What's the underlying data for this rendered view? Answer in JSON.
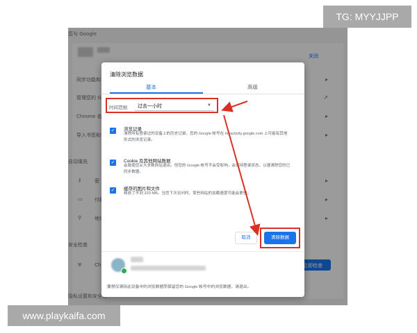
{
  "watermarks": {
    "top_right": "TG: MYYJJPP",
    "bottom_left": "www.playkaifa.com"
  },
  "background_settings": {
    "header": "您与 Google",
    "rows": [
      "同步功能和",
      "管理您的 G",
      "Chrome 名",
      "导入书签和"
    ],
    "sync_button": "关闭",
    "section_autofill": "自动填充",
    "autofill_rows": [
      "密",
      "付款",
      "地址"
    ],
    "section_safety": "安全检查",
    "safety_row": "Chro",
    "safety_button": "立即检查",
    "section_privacy": "隐私设置和安全性"
  },
  "dialog": {
    "title": "清除浏览数据",
    "tabs": {
      "basic": "基本",
      "advanced": "高级"
    },
    "time_range": {
      "label": "时间范围",
      "value": "过去一小时"
    },
    "items": [
      {
        "title": "浏览记录",
        "desc": "清除所有登录过的设备上的历史记录。您的 Google 帐号在 myactivity.google.com 上可能有其他形式的浏览记录。",
        "checked": true
      },
      {
        "title": "Cookie 及其他网站数据",
        "desc": "会致使您从大多数网站退出。但您的 Google 帐号不会受影响，会保持登录状态，以便清除您的已同步数据。",
        "checked": true
      },
      {
        "title": "缓存的图片和文件",
        "desc": "释放了不到 320 MB。当您下次访问时，某些网站的加载速度可能会更慢。",
        "checked": true
      }
    ],
    "buttons": {
      "cancel": "取消",
      "clear": "清除数据"
    },
    "footer": "要想仅清除此设备中的浏览数据而保留您的 Google 帐号中的浏览数据，请退出。",
    "colors": {
      "accent": "#1a73e8",
      "highlight": "#d93025"
    }
  }
}
